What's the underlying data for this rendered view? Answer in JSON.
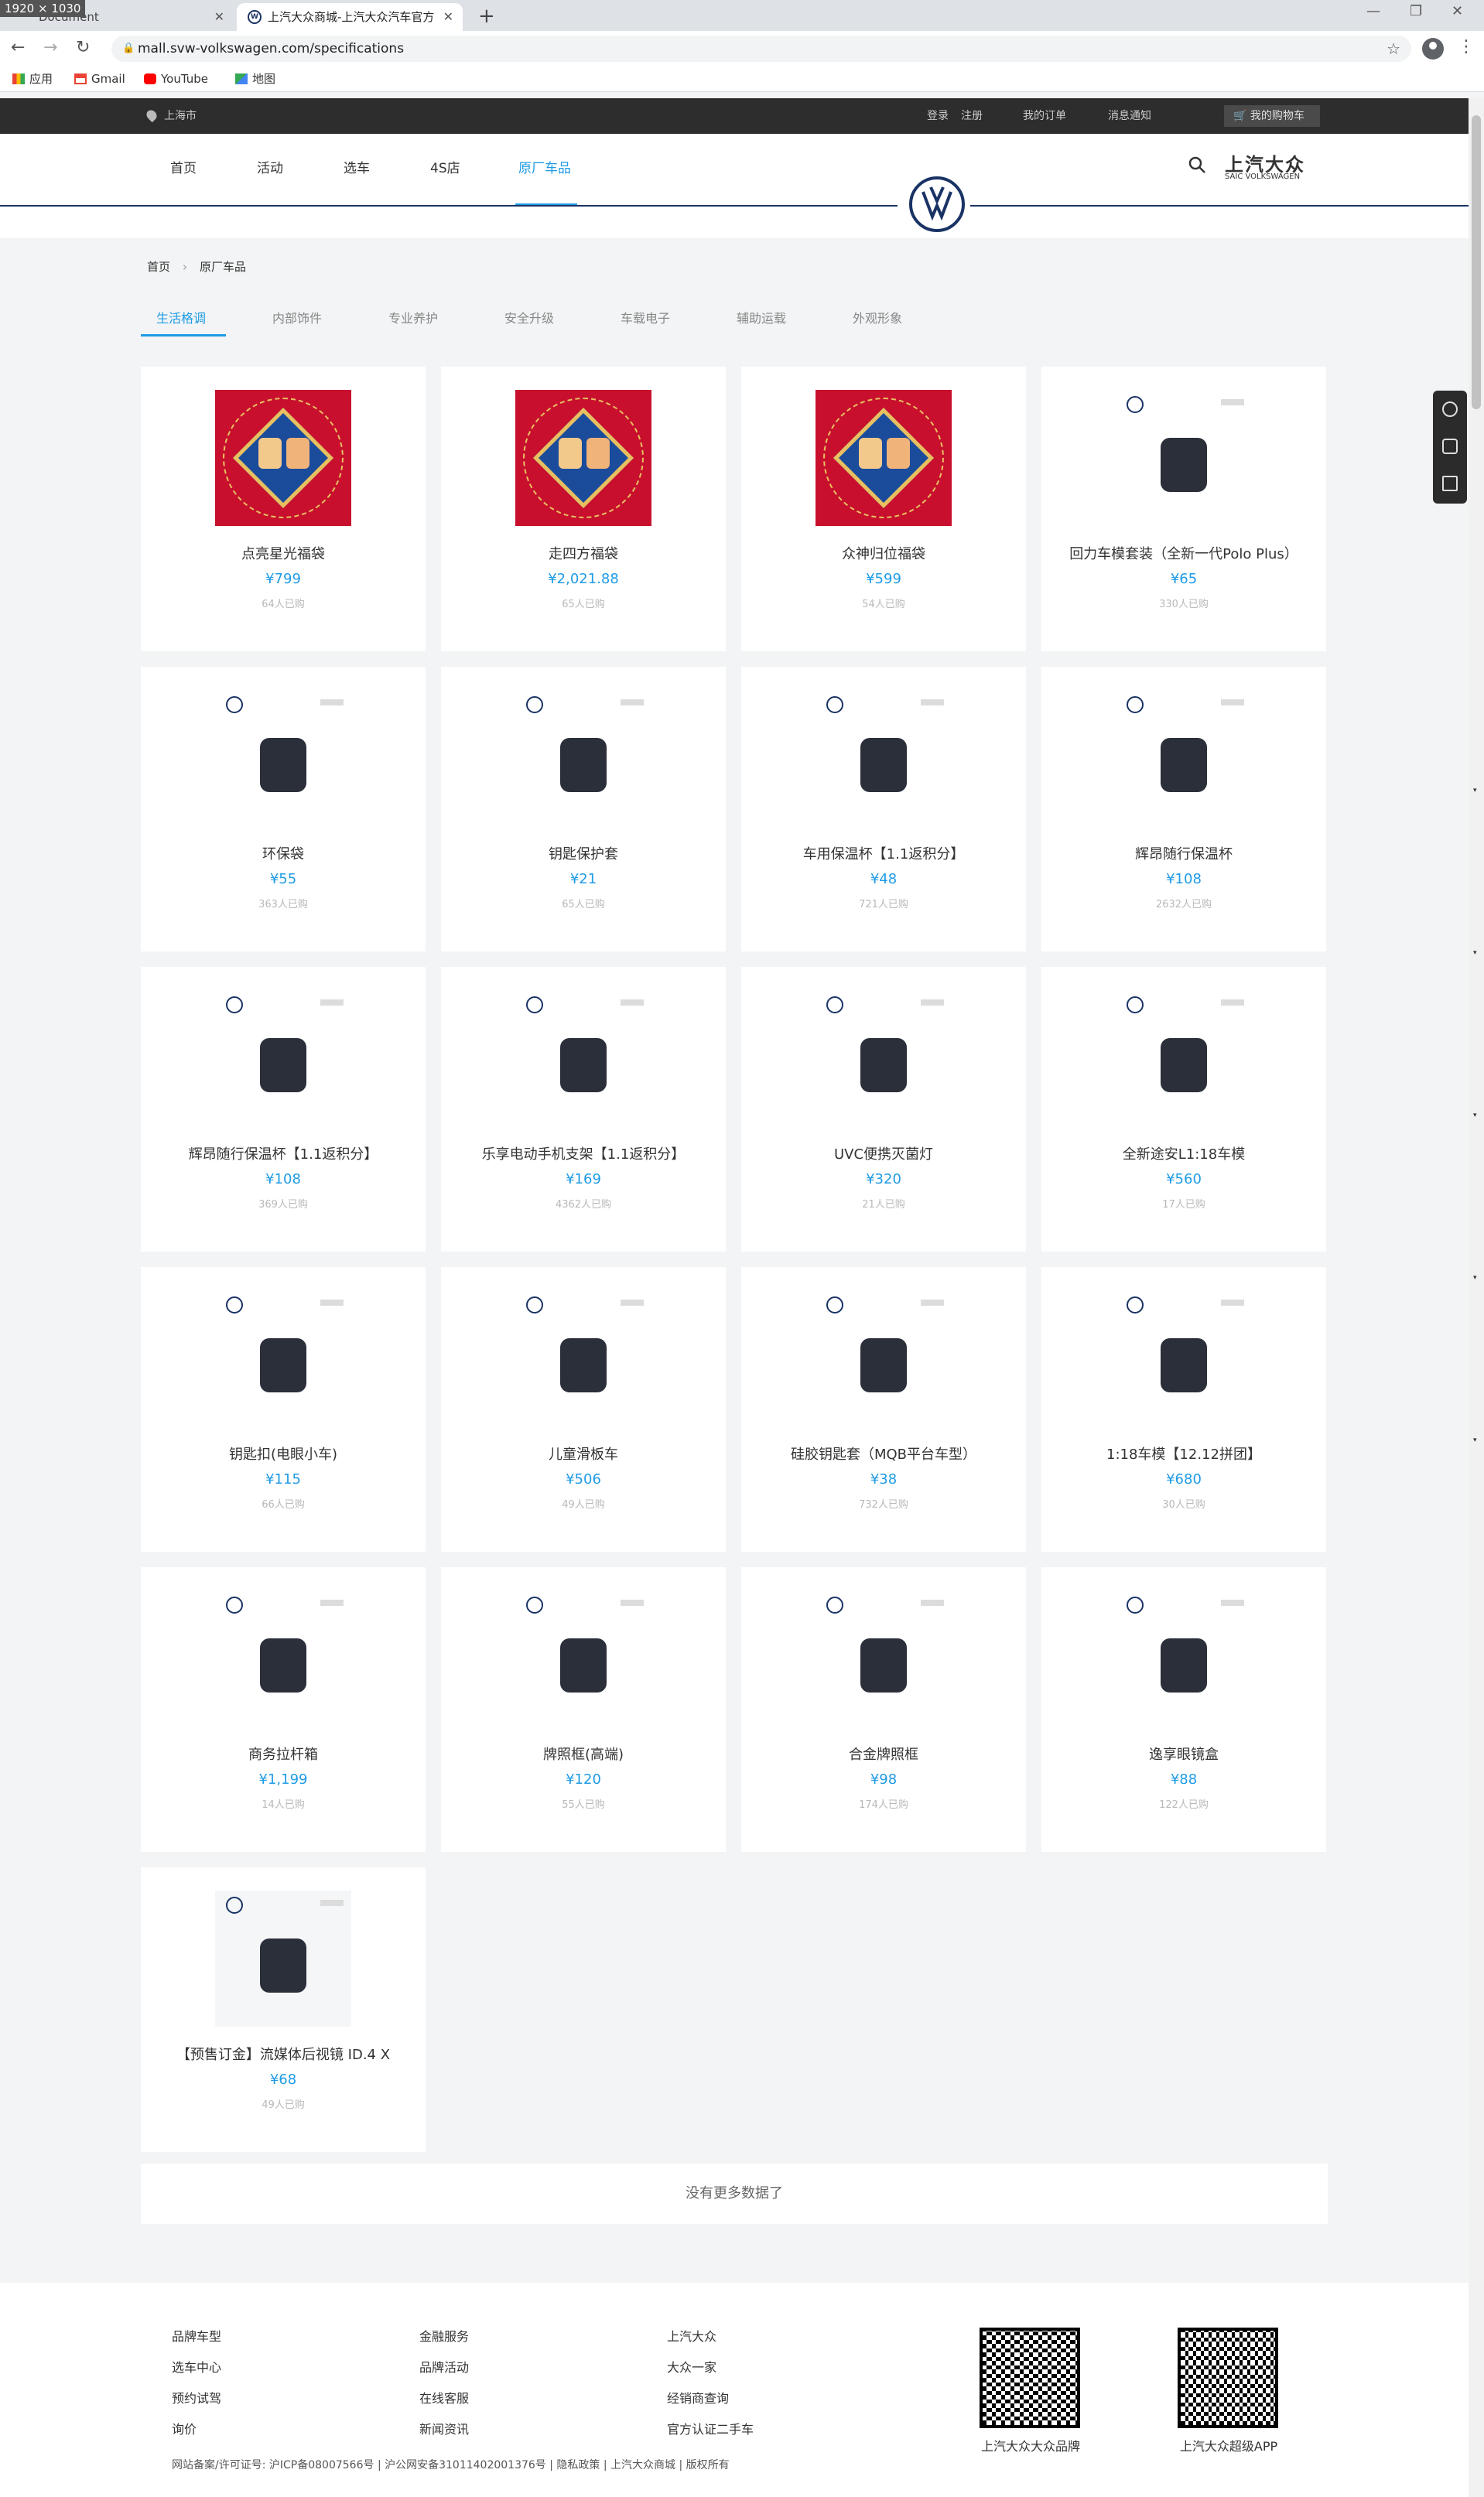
{
  "browser": {
    "dimension_badge": "1920 × 1030",
    "tabs": [
      {
        "title": "Document",
        "active": false
      },
      {
        "title": "上汽大众商城-上汽大众汽车官方",
        "active": true
      }
    ],
    "url": "mall.svw-volkswagen.com/specifications",
    "bookmarks": [
      "应用",
      "Gmail",
      "YouTube",
      "地图"
    ]
  },
  "topbar": {
    "location": "上海市",
    "login": "登录",
    "register": "注册",
    "my_orders": "我的订单",
    "notifications": "消息通知",
    "cart": "我的购物车"
  },
  "nav": {
    "items": [
      "首页",
      "活动",
      "选车",
      "4S店",
      "原厂车品"
    ],
    "active_index": 4,
    "brand": "上汽大众",
    "brand_sub": "SAIC VOLKSWAGEN"
  },
  "breadcrumb": [
    "首页",
    "原厂车品"
  ],
  "categories": [
    "生活格调",
    "内部饰件",
    "专业养护",
    "安全升级",
    "车载电子",
    "辅助运载",
    "外观形象"
  ],
  "active_category": 0,
  "products": [
    {
      "name": "点亮星光福袋",
      "price": "¥799",
      "sold": "64人已购",
      "style": "red"
    },
    {
      "name": "走四方福袋",
      "price": "¥2,021.88",
      "sold": "65人已购",
      "style": "red"
    },
    {
      "name": "众神归位福袋",
      "price": "¥599",
      "sold": "54人已购",
      "style": "red"
    },
    {
      "name": "回力车模套装（全新一代Polo Plus）",
      "price": "¥65",
      "sold": "330人已购",
      "style": "white"
    },
    {
      "name": "环保袋",
      "price": "¥55",
      "sold": "363人已购",
      "style": "white"
    },
    {
      "name": "钥匙保护套",
      "price": "¥21",
      "sold": "65人已购",
      "style": "white"
    },
    {
      "name": "车用保温杯【1.1返积分】",
      "price": "¥48",
      "sold": "721人已购",
      "style": "white"
    },
    {
      "name": "辉昂随行保温杯",
      "price": "¥108",
      "sold": "2632人已购",
      "style": "white"
    },
    {
      "name": "辉昂随行保温杯【1.1返积分】",
      "price": "¥108",
      "sold": "369人已购",
      "style": "white"
    },
    {
      "name": "乐享电动手机支架【1.1返积分】",
      "price": "¥169",
      "sold": "4362人已购",
      "style": "white"
    },
    {
      "name": "UVC便携灭菌灯",
      "price": "¥320",
      "sold": "21人已购",
      "style": "white"
    },
    {
      "name": "全新途安L1:18车模",
      "price": "¥560",
      "sold": "17人已购",
      "style": "white"
    },
    {
      "name": "钥匙扣(电眼小车)",
      "price": "¥115",
      "sold": "66人已购",
      "style": "white"
    },
    {
      "name": "儿童滑板车",
      "price": "¥506",
      "sold": "49人已购",
      "style": "white"
    },
    {
      "name": "硅胶钥匙套（MQB平台车型）",
      "price": "¥38",
      "sold": "732人已购",
      "style": "white"
    },
    {
      "name": "1:18车模【12.12拼团】",
      "price": "¥680",
      "sold": "30人已购",
      "style": "white"
    },
    {
      "name": "商务拉杆箱",
      "price": "¥1,199",
      "sold": "14人已购",
      "style": "white"
    },
    {
      "name": "牌照框(高端)",
      "price": "¥120",
      "sold": "55人已购",
      "style": "white"
    },
    {
      "name": "合金牌照框",
      "price": "¥98",
      "sold": "174人已购",
      "style": "white"
    },
    {
      "name": "逸享眼镜盒",
      "price": "¥88",
      "sold": "122人已购",
      "style": "white"
    },
    {
      "name": "【预售订金】流媒体后视镜 ID.4 X",
      "price": "¥68",
      "sold": "49人已购",
      "style": "grey"
    }
  ],
  "no_more": "没有更多数据了",
  "footer": {
    "col1": [
      "品牌车型",
      "选车中心",
      "预约试驾",
      "询价"
    ],
    "col2": [
      "金融服务",
      "品牌活动",
      "在线客服",
      "新闻资讯"
    ],
    "col3": [
      "上汽大众",
      "大众一家",
      "经销商查询",
      "官方认证二手车"
    ],
    "qr1_caption": "上汽大众大众品牌",
    "qr2_caption": "上汽大众超级APP",
    "copyright": "网站备案/许可证号: 沪ICP备08007566号 | 沪公网安备31011402001376号 | 隐私政策 | 上汽大众商城 | 版权所有"
  },
  "colors": {
    "accent": "#1f9be5",
    "brand_navy": "#1a3365",
    "topbar": "#2d2d2d",
    "festive_red": "#c8102e"
  }
}
